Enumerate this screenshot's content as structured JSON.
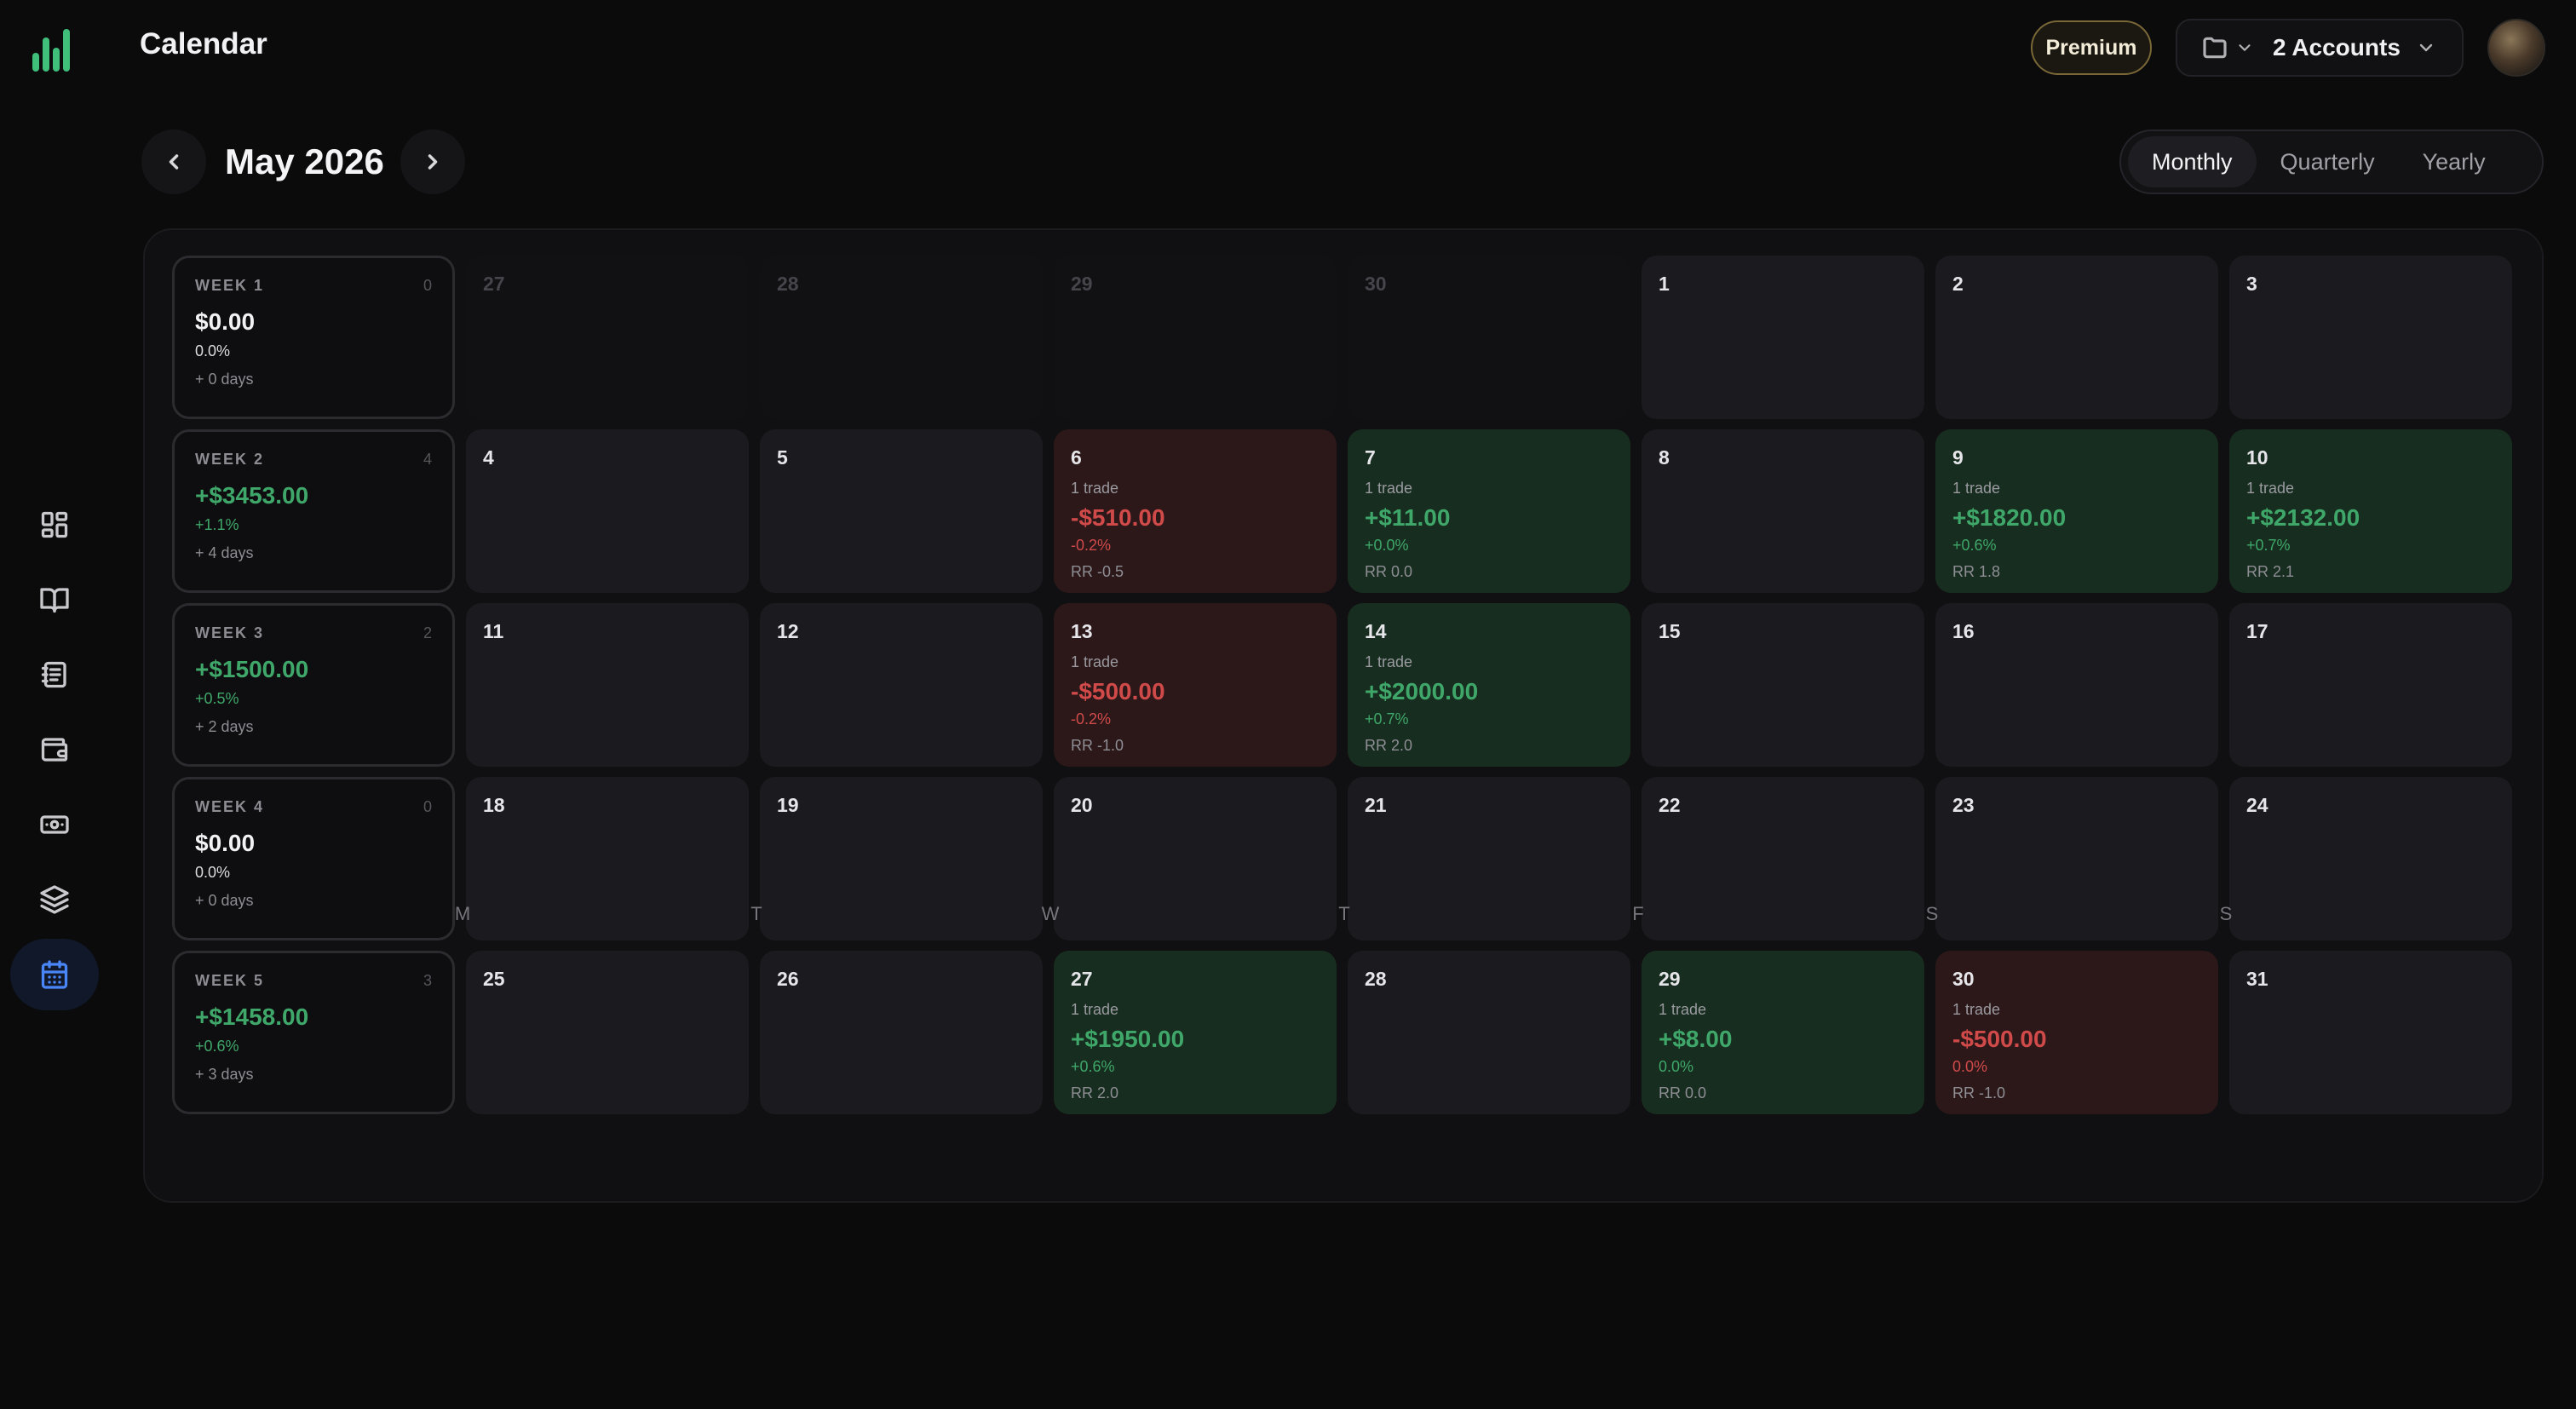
{
  "header": {
    "title": "Calendar",
    "premium_label": "Premium",
    "accounts_label": "2 Accounts"
  },
  "sidebar": {
    "items": [
      {
        "icon": "dashboard-icon",
        "active": false
      },
      {
        "icon": "book-icon",
        "active": false
      },
      {
        "icon": "notebook-icon",
        "active": false
      },
      {
        "icon": "wallet-icon",
        "active": false
      },
      {
        "icon": "cash-icon",
        "active": false
      },
      {
        "icon": "layers-icon",
        "active": false
      },
      {
        "icon": "calendar-icon",
        "active": true
      }
    ]
  },
  "calendar": {
    "month_label": "May 2026",
    "periods": [
      {
        "label": "Monthly",
        "active": true
      },
      {
        "label": "Quarterly",
        "active": false
      },
      {
        "label": "Yearly",
        "active": false
      }
    ],
    "weekday_labels": [
      "M",
      "T",
      "W",
      "T",
      "F",
      "S",
      "S"
    ],
    "weeks": [
      {
        "label": "WEEK 1",
        "count": "0",
        "pnl": "$0.00",
        "pct": "0.0%",
        "days": "+ 0 days",
        "positive": false,
        "days_list": [
          {
            "num": "27",
            "outside": true
          },
          {
            "num": "28",
            "outside": true
          },
          {
            "num": "29",
            "outside": true
          },
          {
            "num": "30",
            "outside": true
          },
          {
            "num": "1"
          },
          {
            "num": "2"
          },
          {
            "num": "3"
          }
        ]
      },
      {
        "label": "WEEK 2",
        "count": "4",
        "pnl": "+$3453.00",
        "pct": "+1.1%",
        "days": "+ 4 days",
        "positive": true,
        "days_list": [
          {
            "num": "4"
          },
          {
            "num": "5"
          },
          {
            "num": "6",
            "status": "loss",
            "trades": "1 trade",
            "pnl": "-$510.00",
            "pct": "-0.2%",
            "rr": "RR -0.5"
          },
          {
            "num": "7",
            "status": "win",
            "trades": "1 trade",
            "pnl": "+$11.00",
            "pct": "+0.0%",
            "rr": "RR 0.0"
          },
          {
            "num": "8"
          },
          {
            "num": "9",
            "status": "win",
            "trades": "1 trade",
            "pnl": "+$1820.00",
            "pct": "+0.6%",
            "rr": "RR 1.8"
          },
          {
            "num": "10",
            "status": "win",
            "trades": "1 trade",
            "pnl": "+$2132.00",
            "pct": "+0.7%",
            "rr": "RR 2.1"
          }
        ]
      },
      {
        "label": "WEEK 3",
        "count": "2",
        "pnl": "+$1500.00",
        "pct": "+0.5%",
        "days": "+ 2 days",
        "positive": true,
        "days_list": [
          {
            "num": "11"
          },
          {
            "num": "12"
          },
          {
            "num": "13",
            "status": "loss",
            "trades": "1 trade",
            "pnl": "-$500.00",
            "pct": "-0.2%",
            "rr": "RR -1.0"
          },
          {
            "num": "14",
            "status": "win",
            "trades": "1 trade",
            "pnl": "+$2000.00",
            "pct": "+0.7%",
            "rr": "RR 2.0"
          },
          {
            "num": "15"
          },
          {
            "num": "16"
          },
          {
            "num": "17"
          }
        ]
      },
      {
        "label": "WEEK 4",
        "count": "0",
        "pnl": "$0.00",
        "pct": "0.0%",
        "days": "+ 0 days",
        "positive": false,
        "days_list": [
          {
            "num": "18"
          },
          {
            "num": "19"
          },
          {
            "num": "20"
          },
          {
            "num": "21"
          },
          {
            "num": "22"
          },
          {
            "num": "23"
          },
          {
            "num": "24"
          }
        ]
      },
      {
        "label": "WEEK 5",
        "count": "3",
        "pnl": "+$1458.00",
        "pct": "+0.6%",
        "days": "+ 3 days",
        "positive": true,
        "days_list": [
          {
            "num": "25"
          },
          {
            "num": "26"
          },
          {
            "num": "27",
            "status": "win",
            "trades": "1 trade",
            "pnl": "+$1950.00",
            "pct": "+0.6%",
            "rr": "RR 2.0"
          },
          {
            "num": "28"
          },
          {
            "num": "29",
            "status": "win",
            "trades": "1 trade",
            "pnl": "+$8.00",
            "pct": "0.0%",
            "rr": "RR 0.0"
          },
          {
            "num": "30",
            "status": "loss",
            "trades": "1 trade",
            "pnl": "-$500.00",
            "pct": "0.0%",
            "rr": "RR -1.0"
          },
          {
            "num": "31"
          }
        ]
      }
    ]
  },
  "colors": {
    "accent": "#4a86f7",
    "brand": "#3fbf7a",
    "win": "#3fa769",
    "loss": "#d04a4a",
    "premium_border": "#7a6737"
  }
}
